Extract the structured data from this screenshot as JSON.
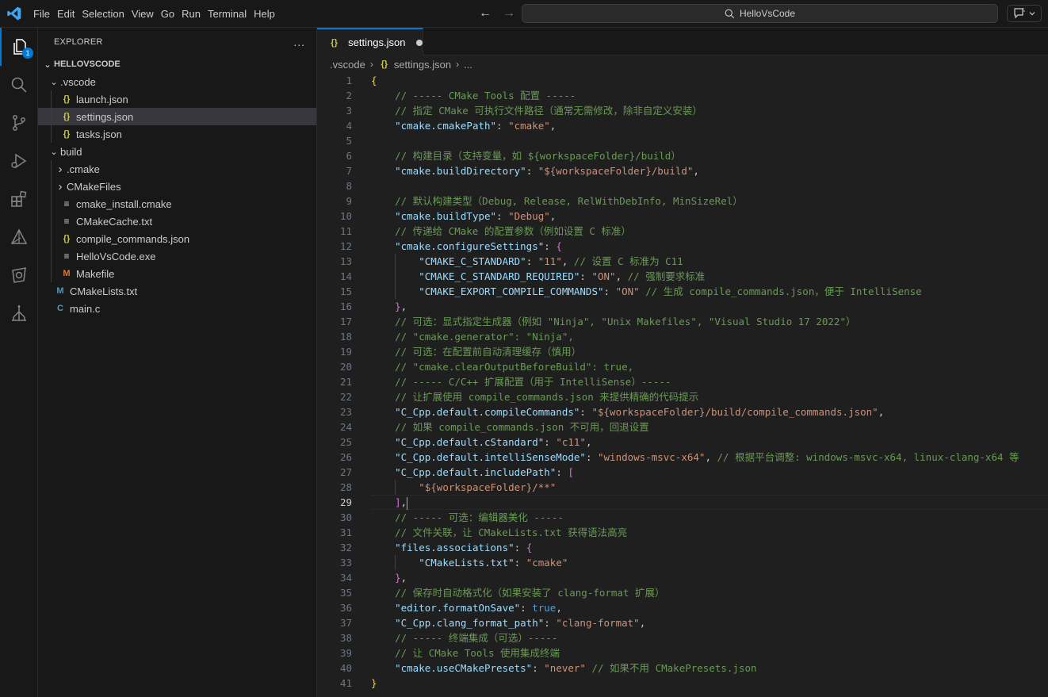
{
  "menu": [
    "File",
    "Edit",
    "Selection",
    "View",
    "Go",
    "Run",
    "Terminal",
    "Help"
  ],
  "search": {
    "text": "HelloVsCode"
  },
  "activity": {
    "explorer_badge": "1"
  },
  "sidebar": {
    "title": "EXPLORER",
    "more": "...",
    "root": "HELLOVSCODE",
    "tree": [
      {
        "label": ".vscode",
        "depth": 1,
        "type": "folder",
        "open": true
      },
      {
        "label": "launch.json",
        "depth": 2,
        "type": "json"
      },
      {
        "label": "settings.json",
        "depth": 2,
        "type": "json",
        "selected": true
      },
      {
        "label": "tasks.json",
        "depth": 2,
        "type": "json"
      },
      {
        "label": "build",
        "depth": 1,
        "type": "folder",
        "open": true
      },
      {
        "label": ".cmake",
        "depth": 2,
        "type": "folder",
        "open": false
      },
      {
        "label": "CMakeFiles",
        "depth": 2,
        "type": "folder",
        "open": false
      },
      {
        "label": "cmake_install.cmake",
        "depth": 2,
        "type": "lines"
      },
      {
        "label": "CMakeCache.txt",
        "depth": 2,
        "type": "lines"
      },
      {
        "label": "compile_commands.json",
        "depth": 2,
        "type": "json"
      },
      {
        "label": "HelloVsCode.exe",
        "depth": 2,
        "type": "lines"
      },
      {
        "label": "Makefile",
        "depth": 2,
        "type": "makefile"
      },
      {
        "label": "CMakeLists.txt",
        "depth": 1,
        "type": "cmake"
      },
      {
        "label": "main.c",
        "depth": 1,
        "type": "c"
      }
    ]
  },
  "tab": {
    "label": "settings.json"
  },
  "breadcrumb": {
    "folder": ".vscode",
    "file": "settings.json",
    "tail": "..."
  },
  "editor": {
    "current_line": 29,
    "lines": [
      [
        [
          "b1",
          "{"
        ]
      ],
      [
        [
          "c",
          "    // ----- CMake Tools 配置 -----"
        ]
      ],
      [
        [
          "c",
          "    // 指定 CMake 可执行文件路径（通常无需修改，除非自定义安装）"
        ]
      ],
      [
        [
          "p",
          "    "
        ],
        [
          "k",
          "\"cmake.cmakePath\""
        ],
        [
          "p",
          ": "
        ],
        [
          "s",
          "\"cmake\""
        ],
        [
          "p",
          ","
        ]
      ],
      [
        [
          "p",
          ""
        ]
      ],
      [
        [
          "c",
          "    // 构建目录（支持变量，如 ${workspaceFolder}/build）"
        ]
      ],
      [
        [
          "p",
          "    "
        ],
        [
          "k",
          "\"cmake.buildDirectory\""
        ],
        [
          "p",
          ": "
        ],
        [
          "s",
          "\"${workspaceFolder}/build\""
        ],
        [
          "p",
          ","
        ]
      ],
      [
        [
          "p",
          ""
        ]
      ],
      [
        [
          "c",
          "    // 默认构建类型（Debug, Release, RelWithDebInfo, MinSizeRel）"
        ]
      ],
      [
        [
          "p",
          "    "
        ],
        [
          "k",
          "\"cmake.buildType\""
        ],
        [
          "p",
          ": "
        ],
        [
          "s",
          "\"Debug\""
        ],
        [
          "p",
          ","
        ]
      ],
      [
        [
          "c",
          "    // 传递给 CMake 的配置参数（例如设置 C 标准）"
        ]
      ],
      [
        [
          "p",
          "    "
        ],
        [
          "k",
          "\"cmake.configureSettings\""
        ],
        [
          "p",
          ": "
        ],
        [
          "b2",
          "{"
        ]
      ],
      [
        [
          "p",
          "        "
        ],
        [
          "k",
          "\"CMAKE_C_STANDARD\""
        ],
        [
          "p",
          ": "
        ],
        [
          "s",
          "\"11\""
        ],
        [
          "p",
          ", "
        ],
        [
          "c",
          "// 设置 C 标准为 C11"
        ]
      ],
      [
        [
          "p",
          "        "
        ],
        [
          "k",
          "\"CMAKE_C_STANDARD_REQUIRED\""
        ],
        [
          "p",
          ": "
        ],
        [
          "s",
          "\"ON\""
        ],
        [
          "p",
          ", "
        ],
        [
          "c",
          "// 强制要求标准"
        ]
      ],
      [
        [
          "p",
          "        "
        ],
        [
          "k",
          "\"CMAKE_EXPORT_COMPILE_COMMANDS\""
        ],
        [
          "p",
          ": "
        ],
        [
          "s",
          "\"ON\""
        ],
        [
          "p",
          " "
        ],
        [
          "c",
          "// 生成 compile_commands.json，便于 IntelliSense"
        ]
      ],
      [
        [
          "p",
          "    "
        ],
        [
          "b2",
          "}"
        ],
        [
          "p",
          ","
        ]
      ],
      [
        [
          "c",
          "    // 可选：显式指定生成器（例如 \"Ninja\", \"Unix Makefiles\", \"Visual Studio 17 2022\"）"
        ]
      ],
      [
        [
          "c",
          "    // \"cmake.generator\": \"Ninja\","
        ]
      ],
      [
        [
          "c",
          "    // 可选：在配置前自动清理缓存（慎用）"
        ]
      ],
      [
        [
          "c",
          "    // \"cmake.clearOutputBeforeBuild\": true,"
        ]
      ],
      [
        [
          "c",
          "    // ----- C/C++ 扩展配置（用于 IntelliSense）-----"
        ]
      ],
      [
        [
          "c",
          "    // 让扩展使用 compile_commands.json 来提供精确的代码提示"
        ]
      ],
      [
        [
          "p",
          "    "
        ],
        [
          "k",
          "\"C_Cpp.default.compileCommands\""
        ],
        [
          "p",
          ": "
        ],
        [
          "s",
          "\"${workspaceFolder}/build/compile_commands.json\""
        ],
        [
          "p",
          ","
        ]
      ],
      [
        [
          "c",
          "    // 如果 compile_commands.json 不可用，回退设置"
        ]
      ],
      [
        [
          "p",
          "    "
        ],
        [
          "k",
          "\"C_Cpp.default.cStandard\""
        ],
        [
          "p",
          ": "
        ],
        [
          "s",
          "\"c11\""
        ],
        [
          "p",
          ","
        ]
      ],
      [
        [
          "p",
          "    "
        ],
        [
          "k",
          "\"C_Cpp.default.intelliSenseMode\""
        ],
        [
          "p",
          ": "
        ],
        [
          "s",
          "\"windows-msvc-x64\""
        ],
        [
          "p",
          ", "
        ],
        [
          "c",
          "// 根据平台调整: windows-msvc-x64, linux-clang-x64 等"
        ]
      ],
      [
        [
          "p",
          "    "
        ],
        [
          "k",
          "\"C_Cpp.default.includePath\""
        ],
        [
          "p",
          ": "
        ],
        [
          "b2",
          "["
        ]
      ],
      [
        [
          "p",
          "        "
        ],
        [
          "s",
          "\"${workspaceFolder}/**\""
        ]
      ],
      [
        [
          "p",
          "    "
        ],
        [
          "b2",
          "]"
        ],
        [
          "p",
          ","
        ]
      ],
      [
        [
          "c",
          "    // ----- 可选：编辑器美化 -----"
        ]
      ],
      [
        [
          "c",
          "    // 文件关联，让 CMakeLists.txt 获得语法高亮"
        ]
      ],
      [
        [
          "p",
          "    "
        ],
        [
          "k",
          "\"files.associations\""
        ],
        [
          "p",
          ": "
        ],
        [
          "b2",
          "{"
        ]
      ],
      [
        [
          "p",
          "        "
        ],
        [
          "k",
          "\"CMakeLists.txt\""
        ],
        [
          "p",
          ": "
        ],
        [
          "s",
          "\"cmake\""
        ]
      ],
      [
        [
          "p",
          "    "
        ],
        [
          "b2",
          "}"
        ],
        [
          "p",
          ","
        ]
      ],
      [
        [
          "c",
          "    // 保存时自动格式化（如果安装了 clang-format 扩展）"
        ]
      ],
      [
        [
          "p",
          "    "
        ],
        [
          "k",
          "\"editor.formatOnSave\""
        ],
        [
          "p",
          ": "
        ],
        [
          "kw",
          "true"
        ],
        [
          "p",
          ","
        ]
      ],
      [
        [
          "p",
          "    "
        ],
        [
          "k",
          "\"C_Cpp.clang_format_path\""
        ],
        [
          "p",
          ": "
        ],
        [
          "s",
          "\"clang-format\""
        ],
        [
          "p",
          ","
        ]
      ],
      [
        [
          "c",
          "    // ----- 终端集成（可选）-----"
        ]
      ],
      [
        [
          "c",
          "    // 让 CMake Tools 使用集成终端"
        ]
      ],
      [
        [
          "p",
          "    "
        ],
        [
          "k",
          "\"cmake.useCMakePresets\""
        ],
        [
          "p",
          ": "
        ],
        [
          "s",
          "\"never\""
        ],
        [
          "p",
          " "
        ],
        [
          "c",
          "// 如果不用 CMakePresets.json"
        ]
      ],
      [
        [
          "b1",
          "}"
        ]
      ]
    ]
  }
}
